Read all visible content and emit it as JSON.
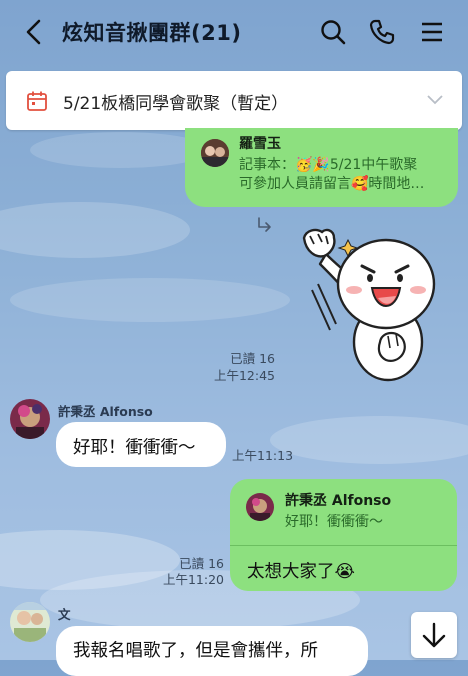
{
  "header": {
    "title": "炫知音揪團群(21)"
  },
  "announcement": {
    "text": "5/21板橋同學會歌聚（暫定）"
  },
  "messages": {
    "m1": {
      "sender": "羅雪玉",
      "line1": "記事本：🥳🎉5/21中午歌聚",
      "line2": "可參加人員請留言🥰時間地…"
    },
    "m2": {
      "read": "已讀 16",
      "time": "上午12:45"
    },
    "m3": {
      "sender": "許秉丞 Alfonso",
      "text": "好耶！衝衝衝～",
      "time": "上午11:13"
    },
    "m4": {
      "quote_sender": "許秉丞 Alfonso",
      "quote_text": "好耶！衝衝衝～",
      "text": "太想大家了😭",
      "read": "已讀 16",
      "time": "上午11:20"
    },
    "m5": {
      "sender": "文",
      "text": "我報名唱歌了，但是會攜伴，所"
    }
  },
  "colors": {
    "accent_green": "#8de07f",
    "calendar_red": "#e2503f"
  }
}
